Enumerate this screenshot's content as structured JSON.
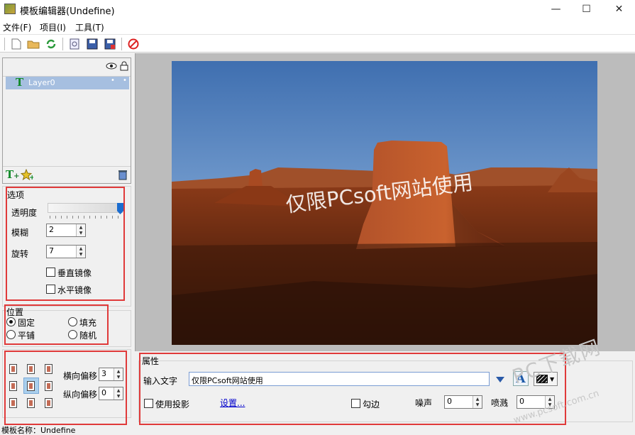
{
  "window": {
    "title": "模板编辑器(Undefine)"
  },
  "menu": {
    "items": [
      "文件(F)",
      "项目(I)",
      "工具(T)"
    ]
  },
  "layers": {
    "items": [
      {
        "name": "Layer0"
      }
    ]
  },
  "options": {
    "group_title": "选项",
    "opacity_label": "透明度",
    "opacity_value": 1.0,
    "blur_label": "模糊",
    "blur_value": "2",
    "rotate_label": "旋转",
    "rotate_value": "7",
    "vflip_label": "垂直镜像",
    "hflip_label": "水平镜像"
  },
  "position": {
    "group_title": "位置",
    "fixed": "固定",
    "fill": "填充",
    "tile": "平铺",
    "random": "随机",
    "selected": "固定"
  },
  "offset": {
    "h_label": "横向偏移",
    "h_value": "3",
    "v_label": "纵向偏移",
    "v_value": "0"
  },
  "canvas": {
    "watermark_text": "仅限PCsoft网站使用"
  },
  "properties": {
    "group_title": "属性",
    "input_label": "输入文字",
    "input_value": "仅限PCsoft网站使用",
    "shadow_label": "使用投影",
    "settings_link": "设置...",
    "stroke_label": "勾边",
    "noise_label": "噪声",
    "noise_value": "0",
    "spray_label": "喷溅",
    "spray_value": "0"
  },
  "status": {
    "template_name": "模板名称：Undefine"
  },
  "site_watermark": {
    "line1": "PC下载网",
    "line2": "www.pcsoft.com.cn"
  },
  "colors": {
    "highlight_red": "#e03a3a",
    "selection_blue": "#a6bfe0",
    "link_blue": "#0000cc"
  }
}
